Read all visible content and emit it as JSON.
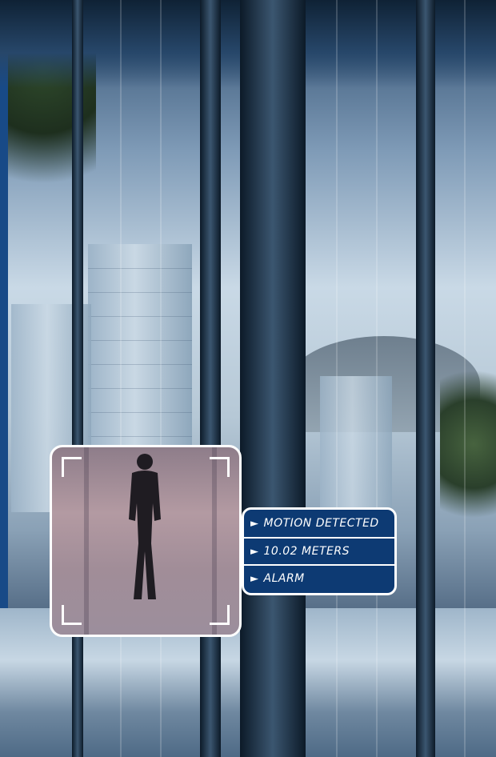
{
  "overlay": {
    "status_rows": [
      {
        "icon": "play-triangle-icon",
        "marker": "►",
        "text": "MOTION DETECTED"
      },
      {
        "icon": "play-triangle-icon",
        "marker": "►",
        "text": "10.02 METERS"
      },
      {
        "icon": "play-triangle-icon",
        "marker": "►",
        "text": "ALARM"
      }
    ]
  },
  "colors": {
    "panel_background": "#0d3a73",
    "panel_border": "#ffffff",
    "left_edge": "#184a87",
    "detection_tint": "#a18d98"
  }
}
